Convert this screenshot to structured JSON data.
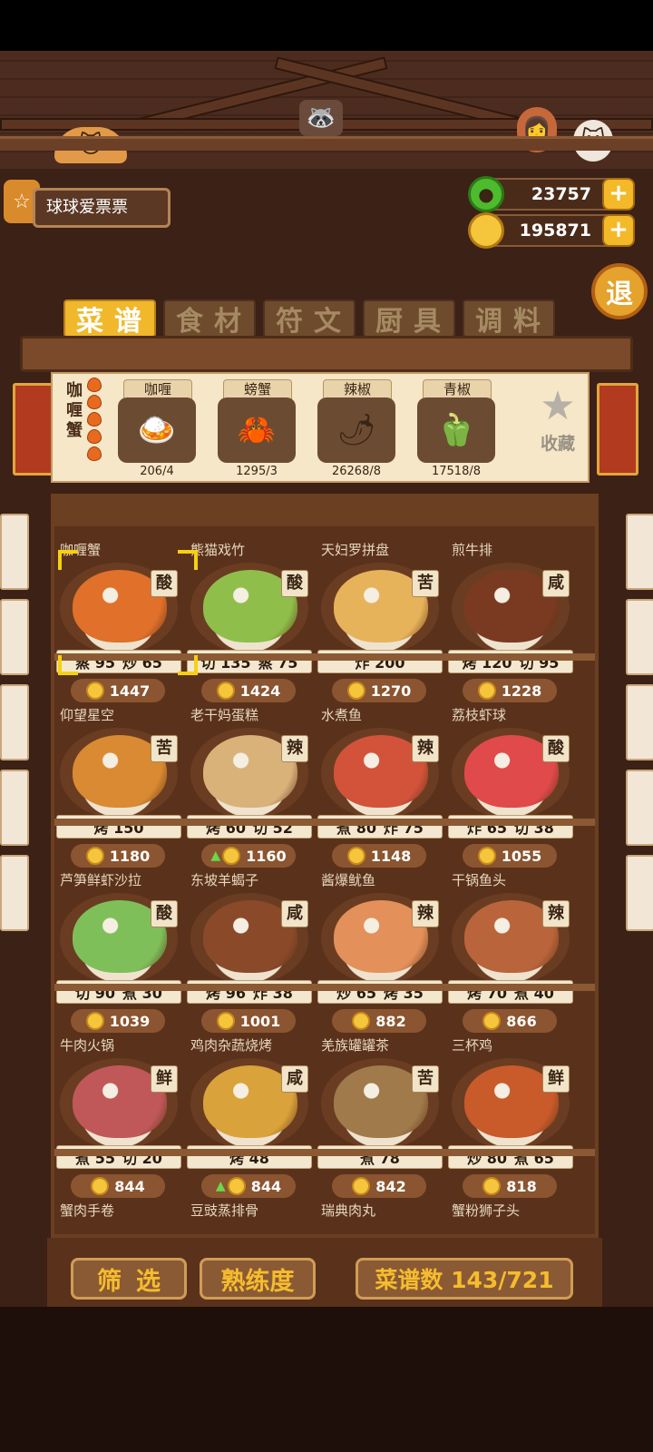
{
  "player": {
    "name": "球球爱票票"
  },
  "currencies": {
    "gems": "23757",
    "coins": "195871",
    "plus": "+"
  },
  "exit_label": "退",
  "tabs": [
    {
      "label": "菜谱",
      "active": true
    },
    {
      "label": "食材",
      "active": false
    },
    {
      "label": "符文",
      "active": false
    },
    {
      "label": "厨具",
      "active": false
    },
    {
      "label": "调料",
      "active": false
    }
  ],
  "selected_dish": {
    "name": "咖喱蟹",
    "flames": 5,
    "ingredients": [
      {
        "name": "咖喱",
        "count": "206/4",
        "icon": "curry-sauce-icon"
      },
      {
        "name": "螃蟹",
        "count": "1295/3",
        "icon": "crab-icon"
      },
      {
        "name": "辣椒",
        "count": "26268/8",
        "icon": "chili-icon"
      },
      {
        "name": "青椒",
        "count": "17518/8",
        "icon": "green-pepper-icon"
      }
    ],
    "favorite_label": "收藏"
  },
  "recipes": [
    {
      "name": "咖喱蟹",
      "taste": "酸",
      "skills": [
        "蒸 95",
        "炒 65"
      ],
      "price": "1447",
      "up": false,
      "color": "#e0702a"
    },
    {
      "name": "熊猫戏竹",
      "taste": "酸",
      "skills": [
        "切 135",
        "蒸 75"
      ],
      "price": "1424",
      "up": false,
      "color": "#8fbf4a"
    },
    {
      "name": "天妇罗拼盘",
      "taste": "苦",
      "skills": [
        "炸 200"
      ],
      "price": "1270",
      "up": false,
      "color": "#e7b35a"
    },
    {
      "name": "煎牛排",
      "taste": "咸",
      "skills": [
        "烤 120",
        "切 95"
      ],
      "price": "1228",
      "up": false,
      "color": "#7a3a22"
    },
    {
      "name": "仰望星空",
      "taste": "苦",
      "skills": [
        "烤 150"
      ],
      "price": "1180",
      "up": false,
      "color": "#d98a32"
    },
    {
      "name": "老干妈蛋糕",
      "taste": "辣",
      "skills": [
        "烤 60",
        "切 52"
      ],
      "price": "1160",
      "up": true,
      "color": "#d9b27a"
    },
    {
      "name": "水煮鱼",
      "taste": "辣",
      "skills": [
        "煮 80",
        "炸 75"
      ],
      "price": "1148",
      "up": false,
      "color": "#d2533a"
    },
    {
      "name": "荔枝虾球",
      "taste": "酸",
      "skills": [
        "炸 65",
        "切 38"
      ],
      "price": "1055",
      "up": false,
      "color": "#e04a4a"
    },
    {
      "name": "芦笋鲜虾沙拉",
      "taste": "酸",
      "skills": [
        "切 90",
        "煮 30"
      ],
      "price": "1039",
      "up": false,
      "color": "#7fbf5a"
    },
    {
      "name": "东坡羊蝎子",
      "taste": "咸",
      "skills": [
        "烤 96",
        "炸 38"
      ],
      "price": "1001",
      "up": false,
      "color": "#8a4a2a"
    },
    {
      "name": "酱爆鱿鱼",
      "taste": "辣",
      "skills": [
        "炒 65",
        "烤 35"
      ],
      "price": "882",
      "up": false,
      "color": "#e3905a"
    },
    {
      "name": "干锅鱼头",
      "taste": "辣",
      "skills": [
        "烤 70",
        "煮 40"
      ],
      "price": "866",
      "up": false,
      "color": "#b9643a"
    },
    {
      "name": "牛肉火锅",
      "taste": "鲜",
      "skills": [
        "煮 55",
        "切 20"
      ],
      "price": "844",
      "up": false,
      "color": "#c0585a"
    },
    {
      "name": "鸡肉杂蔬烧烤",
      "taste": "咸",
      "skills": [
        "烤 48"
      ],
      "price": "844",
      "up": true,
      "color": "#d9a23a"
    },
    {
      "name": "羌族罐罐茶",
      "taste": "苦",
      "skills": [
        "煮 78"
      ],
      "price": "842",
      "up": false,
      "color": "#a07a4a"
    },
    {
      "name": "三杯鸡",
      "taste": "鲜",
      "skills": [
        "炒 80",
        "煮 65"
      ],
      "price": "818",
      "up": false,
      "color": "#c95a2a"
    },
    {
      "name": "蟹肉手卷",
      "taste": "",
      "skills": [],
      "price": "",
      "up": false,
      "color": "#5a321b"
    },
    {
      "name": "豆豉蒸排骨",
      "taste": "",
      "skills": [],
      "price": "",
      "up": false,
      "color": "#5a321b"
    },
    {
      "name": "瑞典肉丸",
      "taste": "",
      "skills": [],
      "price": "",
      "up": false,
      "color": "#5a321b"
    },
    {
      "name": "蟹粉狮子头",
      "taste": "",
      "skills": [],
      "price": "",
      "up": false,
      "color": "#5a321b"
    }
  ],
  "bottom": {
    "filter": "筛选",
    "proficiency": "熟练度",
    "recipe_count": "菜谱数 143/721"
  }
}
